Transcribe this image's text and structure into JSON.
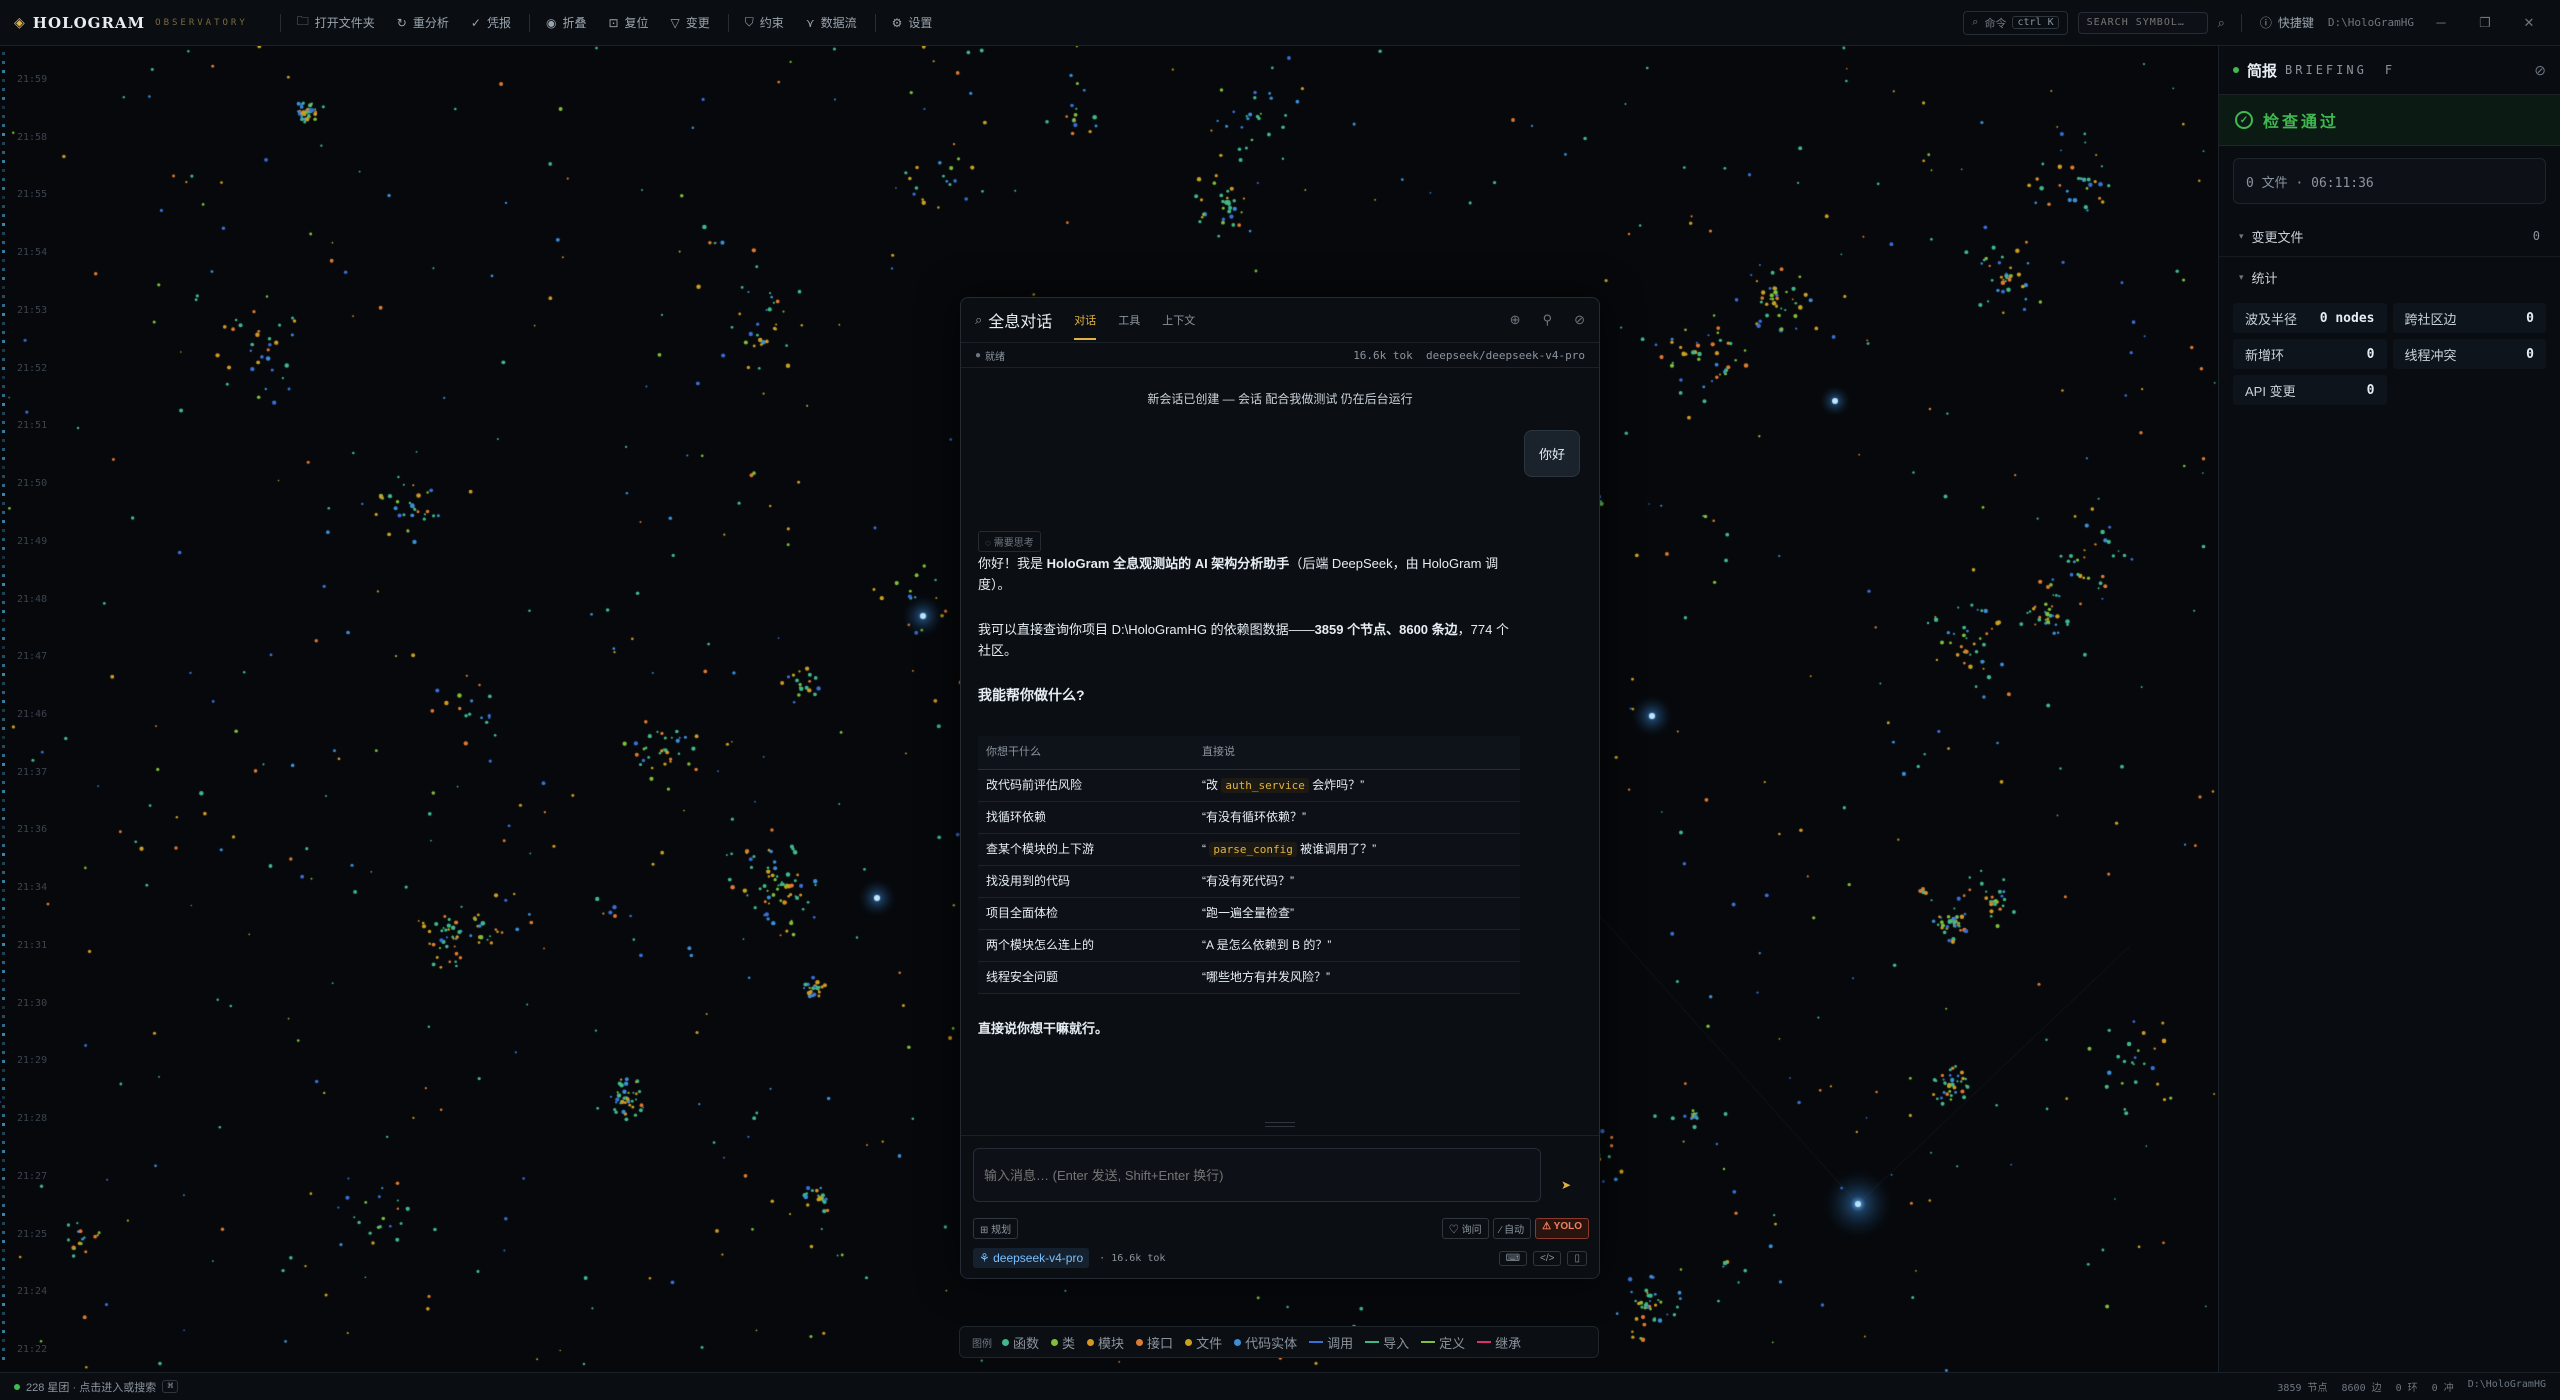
{
  "app": {
    "logo": "HOLOGRAM",
    "logo_sub": "OBSERVATORY"
  },
  "toolbar": {
    "items": [
      {
        "icon": "folder-icon",
        "label": "打开文件夹"
      },
      {
        "icon": "refresh-icon",
        "label": "重分析"
      },
      {
        "icon": "check-icon",
        "label": "凭报"
      },
      {
        "icon": "eye-icon",
        "label": "折叠"
      },
      {
        "icon": "reset-icon",
        "label": "复位"
      },
      {
        "icon": "filter-icon",
        "label": "变更"
      },
      {
        "icon": "shield-icon",
        "label": "约束"
      },
      {
        "icon": "flow-icon",
        "label": "数据流"
      },
      {
        "icon": "gear-icon",
        "label": "设置"
      }
    ],
    "command_label": "命令",
    "command_kbd": "ctrl K",
    "search_placeholder": "SEARCH SYMBOL…",
    "quick_label": "快捷键",
    "path": "D:\\HoloGramHG"
  },
  "timeline": {
    "labels": [
      "21:59",
      "21:58",
      "21:55",
      "21:54",
      "21:53",
      "21:52",
      "21:51",
      "21:50",
      "21:49",
      "21:48",
      "21:47",
      "21:46",
      "21:37",
      "21:36",
      "21:34",
      "21:31",
      "21:30",
      "21:29",
      "21:28",
      "21:27",
      "21:25",
      "21:24",
      "21:22"
    ]
  },
  "right_panel": {
    "title": "简报",
    "subtitle": "BRIEFING",
    "f_label": "F",
    "status": "检查通过",
    "info": "0 文件 · 06:11:36",
    "changed_files_label": "变更文件",
    "changed_files_count": "0",
    "stats_label": "统计",
    "stats": [
      {
        "label": "波及半径",
        "value": "0 nodes"
      },
      {
        "label": "跨社区边",
        "value": "0"
      },
      {
        "label": "新增环",
        "value": "0"
      },
      {
        "label": "线程冲突",
        "value": "0"
      },
      {
        "label": "API 变更",
        "value": "0"
      }
    ]
  },
  "chat": {
    "title": "全息对话",
    "tabs": [
      "对话",
      "工具",
      "上下文"
    ],
    "status_label": "就绪",
    "tokens": "16.6k tok",
    "model": "deepseek/deepseek-v4-pro",
    "system_msg": "新会话已创建 — 会话 配合我做测试 仍在后台运行",
    "user_msg": "你好",
    "thinking_label": "需要思考",
    "ai_intro_pre": "你好！我是 ",
    "ai_intro_bold": "HoloGram 全息观测站的 AI 架构分析助手",
    "ai_intro_post": "（后端 DeepSeek，由 HoloGram 调度）。",
    "ai_p2_pre": "我可以直接查询你项目 D:\\HoloGramHG 的依赖图数据——",
    "ai_p2_bold": "3859 个节点、8600 条边",
    "ai_p2_post": "，774 个社区。",
    "ai_heading": "我能帮你做什么?",
    "table_headers": [
      "你想干什么",
      "直接说"
    ],
    "table_rows": [
      {
        "a": "改代码前评估风险",
        "b_pre": "“改 ",
        "b_code": "auth_service",
        "b_post": " 会炸吗？”"
      },
      {
        "a": "找循环依赖",
        "b_pre": "“有没有循环依赖？”",
        "b_code": "",
        "b_post": ""
      },
      {
        "a": "查某个模块的上下游",
        "b_pre": "“ ",
        "b_code": "parse_config",
        "b_post": " 被谁调用了？”"
      },
      {
        "a": "找没用到的代码",
        "b_pre": "“有没有死代码？”",
        "b_code": "",
        "b_post": ""
      },
      {
        "a": "项目全面体检",
        "b_pre": "“跑一遍全量检查”",
        "b_code": "",
        "b_post": ""
      },
      {
        "a": "两个模块怎么连上的",
        "b_pre": "“A 是怎么依赖到 B 的？”",
        "b_code": "",
        "b_post": ""
      },
      {
        "a": "线程安全问题",
        "b_pre": "“哪些地方有并发风险？”",
        "b_code": "",
        "b_post": ""
      }
    ],
    "ai_outro": "直接说你想干嘛就行。",
    "input_placeholder": "输入消息… (Enter 发送, Shift+Enter 换行)",
    "plan_label": "规划",
    "modes": [
      "询问",
      "自动",
      "YOLO"
    ],
    "model_short": "deepseek-v4-pro",
    "model_tokens": "· 16.6k tok"
  },
  "legend": {
    "title": "图例",
    "nodes": [
      {
        "label": "函数",
        "color": "#3fb98a"
      },
      {
        "label": "类",
        "color": "#7fbf3a"
      },
      {
        "label": "模块",
        "color": "#d29922"
      },
      {
        "label": "接口",
        "color": "#e07a30"
      },
      {
        "label": "文件",
        "color": "#c9a020"
      },
      {
        "label": "代码实体",
        "color": "#3a8fd9"
      }
    ],
    "edges": [
      {
        "label": "调用",
        "color": "#3a6fd9"
      },
      {
        "label": "导入",
        "color": "#3fb98a"
      },
      {
        "label": "定义",
        "color": "#7fbf3a"
      },
      {
        "label": "继承",
        "color": "#d9306f"
      }
    ]
  },
  "status": {
    "count": "228 星团",
    "hint": "· 点击进入或搜索",
    "kbd": "⌘",
    "nodes": "3859 节点",
    "edges": "8600 边",
    "right3": "0 环",
    "right4": "0 冲",
    "path": "D:\\HoloGramHG"
  }
}
